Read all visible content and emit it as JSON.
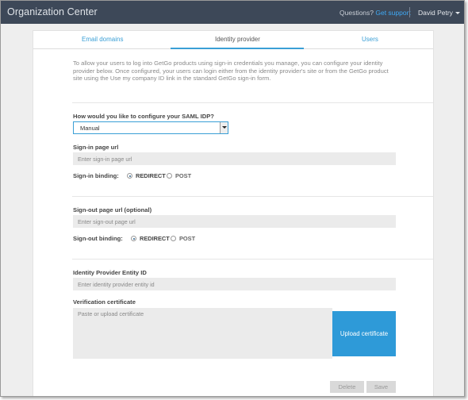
{
  "header": {
    "app_title": "Organization Center",
    "questions_label": "Questions?",
    "support_link": "Get support",
    "user_name": "David Petry"
  },
  "tabs": [
    {
      "label": "Email domains",
      "active": false
    },
    {
      "label": "Identity provider",
      "active": true
    },
    {
      "label": "Users",
      "active": false
    }
  ],
  "intro_text": "To allow your users to log into GetGo products using sign-in credentials you manage, you can configure your identity provider below. Once configured, your users can login either from the identity provider's site or from the GetGo product site using the Use my company ID link in the standard GetGo sign-in form.",
  "saml": {
    "question": "How would you like to configure your SAML IDP?",
    "selected": "Manual"
  },
  "sign_in": {
    "label": "Sign-in page url",
    "placeholder": "Enter sign-in page url",
    "binding_label": "Sign-in binding:",
    "options": [
      "REDIRECT",
      "POST"
    ],
    "selected": "REDIRECT"
  },
  "sign_out": {
    "label": "Sign-out page url (optional)",
    "placeholder": "Enter sign-out page url",
    "binding_label": "Sign-out binding:",
    "options": [
      "REDIRECT",
      "POST"
    ],
    "selected": "REDIRECT"
  },
  "entity": {
    "label": "Identity Provider Entity ID",
    "placeholder": "Enter identity provider entity id"
  },
  "certificate": {
    "label": "Verification certificate",
    "placeholder": "Paste or upload certificate",
    "upload_label": "Upload certificate"
  },
  "actions": {
    "delete_label": "Delete",
    "save_label": "Save"
  }
}
